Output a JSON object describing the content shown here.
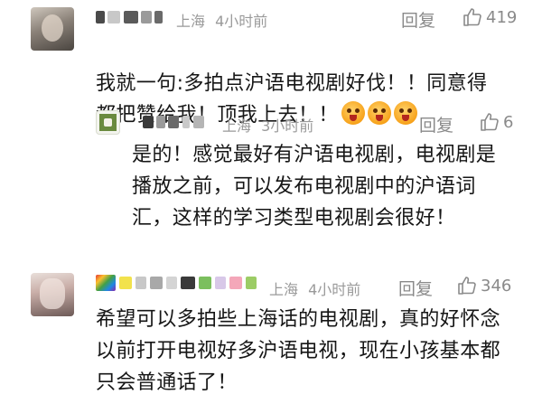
{
  "comments": [
    {
      "location": "上海",
      "time": "4小时前",
      "reply_label": "回复",
      "likes": "419",
      "text": "我就一句:多拍点沪语电视剧好伐！！同意得\n都把赞给我！顶我上去！！",
      "emoji_count": 3,
      "reply": {
        "location": "上海",
        "time": "3小时前",
        "reply_label": "回复",
        "likes": "6",
        "text": "是的！感觉最好有沪语电视剧，电视剧是\n播放之前，可以发布电视剧中的沪语词\n汇，这样的学习类型电视剧会很好！"
      }
    },
    {
      "location": "上海",
      "time": "4小时前",
      "reply_label": "回复",
      "likes": "346",
      "text": "希望可以多拍些上海话的电视剧，真的好怀念\n以前打开电视好多沪语电视，现在小孩基本都\n只会普通话了！"
    }
  ],
  "icons": {
    "like": "thumb-up-icon",
    "emoji": "surprised-face-emoji"
  },
  "colors": {
    "meta": "#9a9a9a",
    "text": "#161616",
    "action": "#8a8a8a"
  }
}
